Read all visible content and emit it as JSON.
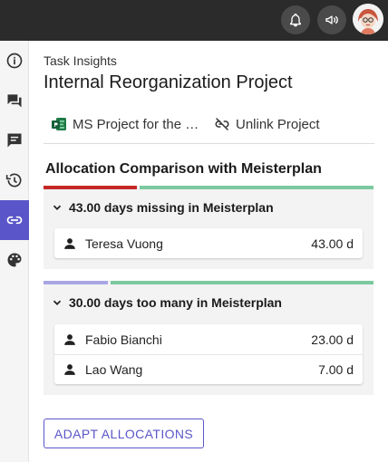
{
  "topbar": {
    "icons": [
      "bell-icon",
      "megaphone-icon",
      "user-avatar"
    ],
    "bg_color": "#2b2b2b"
  },
  "sidebar": {
    "items": [
      {
        "icon": "info-icon",
        "active": false
      },
      {
        "icon": "chat-icon",
        "active": false
      },
      {
        "icon": "comment-icon",
        "active": false
      },
      {
        "icon": "history-icon",
        "active": false
      },
      {
        "icon": "link-icon",
        "active": true
      },
      {
        "icon": "palette-icon",
        "active": false
      }
    ],
    "active_color": "#5a56c9"
  },
  "header": {
    "overline": "Task Insights",
    "title": "Internal Reorganization Project"
  },
  "links": {
    "project_link": "MS Project for the …",
    "unlink": "Unlink Project"
  },
  "allocation": {
    "title": "Allocation Comparison with Meisterplan",
    "groups": [
      {
        "label": "43.00 days missing in Meisterplan",
        "bar_colors": [
          "#c62828",
          "#7cc8a0"
        ],
        "rows": [
          {
            "name": "Teresa Vuong",
            "value": "43.00 d"
          }
        ]
      },
      {
        "label": "30.00 days too many in Meisterplan",
        "bar_colors": [
          "#a9a6e6",
          "#7cc8a0"
        ],
        "rows": [
          {
            "name": "Fabio Bianchi",
            "value": "23.00 d"
          },
          {
            "name": "Lao Wang",
            "value": "7.00 d"
          }
        ]
      }
    ]
  },
  "actions": {
    "adapt_label": "ADAPT ALLOCATIONS"
  }
}
